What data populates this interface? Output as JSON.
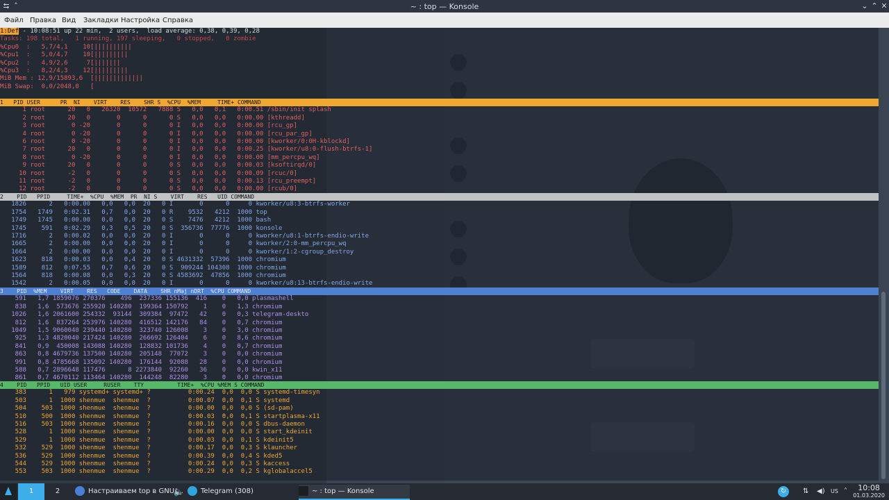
{
  "window": {
    "title": "~ : top — Konsole"
  },
  "menu": [
    "Файл",
    "Правка",
    "Вид",
    "Закладки",
    "Настройка",
    "Справка"
  ],
  "top": {
    "window_tag": "1:Def",
    "uptime_line": " - 10:08:51 up 22 min,  2 users,  load average: 0,38, 0,39, 0,28",
    "tasks_line": "Tasks: 198 total,   1 running, 197 sleeping,   0 stopped,   0 zombie",
    "cpu_lines": [
      "%Cpu0  :   5,7/4,1    10[||||||||||",
      "%Cpu1  :   5,0/4,7    10[|||||||||",
      "%Cpu2  :   4,9/2,6     7[|||||||",
      "%Cpu3  :   8,2/4,3    12[|||||||||"
    ],
    "mem_lines": [
      "MiB Mem : 12,9/15893,6  [|||||||||||||",
      "MiB Swap:  0,0/2048,0   ["
    ],
    "sections": [
      {
        "header": "1   PID USER      PR  NI    VIRT    RES    SHR S  %CPU  %MEM     TIME+ COMMAND",
        "color_key": "#f0a830",
        "rows": [
          "      1 root      20   0   26320  10572   7888 S   0,0   0,1   0:00.51 /sbin/init splash",
          "      2 root      20   0       0      0      0 S   0,0   0,0   0:00.00 [kthreadd]",
          "      3 root       0 -20       0      0      0 I   0,0   0,0   0:00.00 [rcu_gp]",
          "      4 root       0 -20       0      0      0 I   0,0   0,0   0:00.00 [rcu_par_gp]",
          "      6 root       0 -20       0      0      0 I   0,0   0,0   0:00.00 [kworker/0:0H-kblockd]",
          "      7 root      20   0       0      0      0 I   0,0   0,0   0:00.25 [kworker/u8:0-flush-btrfs-1]",
          "      8 root       0 -20       0      0      0 I   0,0   0,0   0:00.00 [mm_percpu_wq]",
          "      9 root      20   0       0      0      0 S   0,0   0,0   0:00.03 [ksoftirqd/0]",
          "     10 root      -2   0       0      0      0 S   0,0   0,0   0:00.09 [rcuc/0]",
          "     11 root      -2   0       0      0      0 S   0,0   0,0   0:00.13 [rcu_preempt]",
          "     12 root      -2   0       0      0      0 S   0,0   0,0   0:00.00 [rcub/0]"
        ]
      },
      {
        "header": "2    PID   PPID     TIME+  %CPU  %MEM  PR  NI S    VIRT    RES   UID COMMAND",
        "color_key": "#c0c2c4",
        "rows": [
          "   1826      2   0:00.00   0,0   0,0  20   0 I       0      0     0 kworker/u8:3-btrfs-worker",
          "   1754   1749   0:02.31   0,7   0,0  20   0 R    9532   4212  1000 top",
          "   1749   1745   0:00.00   0,0   0,0  20   0 S    7476   4212  1000 bash",
          "   1745    591   0:02.29   0,3   0,5  20   0 S  356736  77776  1000 konsole",
          "   1716      2   0:00.02   0,0   0,0  20   0 I       0      0     0 kworker/u8:1-btrfs-endio-write",
          "   1665      2   0:00.00   0,0   0,0  20   0 I       0      0     0 kworker/2:0-mm_percpu_wq",
          "   1664      2   0:00.00   0,0   0,0  20   0 I       0      0     0 kworker/1:2-cgroup_destroy",
          "   1623    818   0:00.03   0,0   0,4  20   0 S 4631332  57396  1000 chromium",
          "   1589    812   0:07.55   0,7   0,6  20   0 S  909244 104308  1000 chromium",
          "   1564    818   0:00.08   0,0   0,3  20   0 S 4583692  47856  1000 chromium",
          "   1542      2   0:00.05   0,0   0,0  20   0 I       0      0     0 kworker/u8:13-btrfs-endio-write"
        ]
      },
      {
        "header": "3    PID  %MEM    VIRT    RES   CODE    DATA    SHR nMaj nDRT  %CPU COMMAND",
        "color_key": "#4f7fd0",
        "rows": [
          "    591   1,7 1859076 270376    496  237336 155136  416    0   0,0 plasmashell",
          "    838   1,6  573676 255920 140280  199364 150792    1    0   1,3 chromium",
          "   1026   1,6 2061600 254332  93144  309384  97472   42    0   0,3 telegram-deskto",
          "    812   1,6  837264 253976 140280  416512 142176   84    0   0,7 chromium",
          "   1049   1,5 9060040 239440 140280  323740 126008    3    0   3,0 chromium",
          "    925   1,3 4820040 217424 140280  266692 126404    6    0   8,6 chromium",
          "    841   0,9  450008 143088 140280  128832 101736    4    0   0,7 chromium",
          "    863   0,8 4679736 137500 140280  205148  77072    3    0   0,0 chromium",
          "    991   0,8 4785668 135092 140280  176144  92088   28    0   0,0 chromium",
          "    588   0,7 2896648 117476      8 2273840  92260   36    0   0,0 kwin_x11",
          "    861   0,7 4670112 113464 140280  144248  82280    3    0   0,0 chromium"
        ]
      },
      {
        "header": "4    PID   PPID   UID USER     RUSER    TTY          TIME+  %CPU %MEM S COMMAND",
        "color_key": "#58b86a",
        "rows": [
          "    383      1   979 systemd+ systemd+ ?          0:00.24  0,0  0,0 S systemd-timesyn",
          "    503      1  1000 shenmue  shenmue  ?          0:00.07  0,0  0,1 S systemd",
          "    504    503  1000 shenmue  shenmue  ?          0:00.00  0,0  0,0 S (sd-pam)",
          "    510    500  1000 shenmue  shenmue  ?          0:00.03  0,0  0,1 S startplasma-x11",
          "    516    503  1000 shenmue  shenmue  ?          0:00.16  0,0  0,0 S dbus-daemon",
          "    528      1  1000 shenmue  shenmue  ?          0:00.00  0,0  0,0 S start_kdeinit",
          "    529      1  1000 shenmue  shenmue  ?          0:00.03  0,0  0,1 S kdeinit5",
          "    532    529  1000 shenmue  shenmue  ?          0:00.17  0,0  0,3 S klauncher",
          "    536    529  1000 shenmue  shenmue  ?          0:00.39  0,0  0,4 S kded5",
          "    544    529  1000 shenmue  shenmue  ?          0:00.24  0,0  0,3 S kaccess",
          "    553    503  1000 shenmue  shenmue  ?          0:00.29  0,0  0,2 S kglobalaccel5"
        ]
      }
    ]
  },
  "taskbar": {
    "desktops": [
      "1",
      "2"
    ],
    "tasks": [
      "Настраиваем top в GNU/...",
      "Telegram (308)",
      "~ : top — Konsole"
    ],
    "layout": "US",
    "time": "10:08",
    "date": "01.03.2020"
  },
  "colors": {
    "accent": "#3daee9",
    "section1": "#f0a830",
    "section2": "#c0c2c4",
    "section3": "#4f7fd0",
    "section4": "#58b86a"
  }
}
